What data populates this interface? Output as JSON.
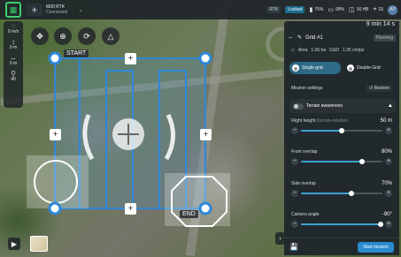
{
  "topbar": {
    "drone_name": "M30 RTK",
    "drone_status": "Connected",
    "rtk": "RTK",
    "locked": "Locked",
    "battery1": "75%",
    "battery2": "99%",
    "distance": "16 HB",
    "count": "15",
    "user_initial": "AP"
  },
  "rail": [
    {
      "value": "0 m/s",
      "icon": "speed-icon"
    },
    {
      "value": "0 m",
      "icon": "height-icon"
    },
    {
      "value": "0 m",
      "icon": "distance-icon"
    },
    {
      "value": "40",
      "icon": "satellite-icon"
    }
  ],
  "waypoints": {
    "start": "START",
    "end": "END"
  },
  "panel": {
    "time": "9 min 14 s",
    "title": "Grid #1",
    "badge": "Planning",
    "area": "Area",
    "area_value": "1.00 ha",
    "gsd": "GSD",
    "gsd_value": "1.35 cm/px",
    "single_grid": "Single grid",
    "double_grid": "Double Grid",
    "mission_settings": "Mission settings",
    "restore": "Restore",
    "terrain": "Terrain awareness",
    "flight_height": "Flight height",
    "flight_height_hint": "(terrain-relative)",
    "flight_height_value": "50 m",
    "front_overlap": "Front overlap",
    "front_overlap_value": "80%",
    "side_overlap": "Side overlap",
    "side_overlap_value": "70%",
    "camera_angle": "Camera angle",
    "camera_angle_value": "-90°",
    "start_mission": "Start mission"
  },
  "sliders": {
    "flight_height": 0.5,
    "front_overlap": 0.75,
    "side_overlap": 0.62,
    "camera_angle": 0.98
  },
  "colors": {
    "accent": "#3fa0cf",
    "route": "#2f87d8",
    "start_button": "#2a8ad0"
  }
}
